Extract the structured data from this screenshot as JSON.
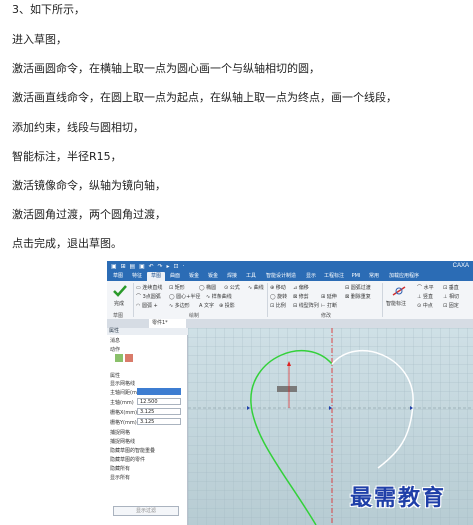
{
  "instructions": [
    "3、如下所示，",
    "进入草图，",
    "激活画圆命令，在横轴上取一点为圆心画一个与纵轴相切的圆，",
    "激活画直线命令，在圆上取一点为起点，在纵轴上取一点为终点，画一个线段，",
    "添加约束，线段与圆相切，",
    "智能标注，半径R15，",
    "激活镜像命令，纵轴为镜向轴，",
    "激活圆角过渡，两个圆角过渡，",
    "点击完成，退出草图。"
  ],
  "app": {
    "title": "CAXA",
    "quick_access": "▣ ⊞ ▤ ▣ ↶ ↷ ▸ ⊡ ·",
    "tabs": [
      "草图",
      "特征",
      "草图",
      "曲面",
      "钣金",
      "钣金",
      "焊接",
      "工具",
      "智能设计制造",
      "显示",
      "工程标注",
      "PMI",
      "常用",
      "加载应用程序"
    ],
    "active_tab_index": 2,
    "ribbon": {
      "finish_label": "完成",
      "group_sketch": "草图",
      "group_draw": "绘制",
      "group_modify": "修改",
      "draw_items": [
        "▭ 连续直线",
        "⊡ 矩形",
        "◯ 椭圆",
        "⊙ 公式",
        "∿ 曲线",
        "⌒ 3点圆弧",
        "◯ 圆心+半径",
        "∿ 样条曲线",
        "◠ 圆弧 +",
        "∿ 多边形",
        "A 文字",
        "⊕ 投影"
      ],
      "modify_items": [
        "⊕ 移动",
        "⊿ 偏移",
        "◯ 旋转",
        "⊠ 修剪",
        "⊞ 阵列",
        "⊞ 延伸",
        "⊡ 比例",
        "⊟ 线型阵列",
        "⊢ 打断",
        "⊟ 圆弧过渡",
        "⊠ 删除重复"
      ],
      "right_items": [
        "⌒ 水平",
        "⊥ 竖直",
        "⊙ 中点",
        "⊡ 垂直",
        "⊥ 相切",
        "⊡ 固定"
      ],
      "right_group": "智能标注"
    },
    "doc_tab": "零件1*",
    "panel": {
      "header": "属性",
      "rows": [
        "消息",
        "动作",
        "属性",
        "显示网格线",
        "主轴间距(mm)",
        "主轴(mm)",
        "栅格X(mm)",
        "栅格Y(mm)",
        "捕捉网格",
        "捕捉网格线",
        "隐藏草图的智能重叠",
        "隐藏草图的零件",
        "隐藏所有",
        "显示所有"
      ],
      "fields": [
        "",
        "12.500",
        "3.125",
        "3.125"
      ],
      "button": "显示过滤"
    }
  },
  "colors": {
    "ribbon_blue": "#2b6cb5",
    "sketch_green": "#33d13a",
    "axis_red": "#e02020",
    "arc_white": "#ffffff",
    "watermark_blue": "#1f3fa8"
  },
  "watermark": "最需教育"
}
